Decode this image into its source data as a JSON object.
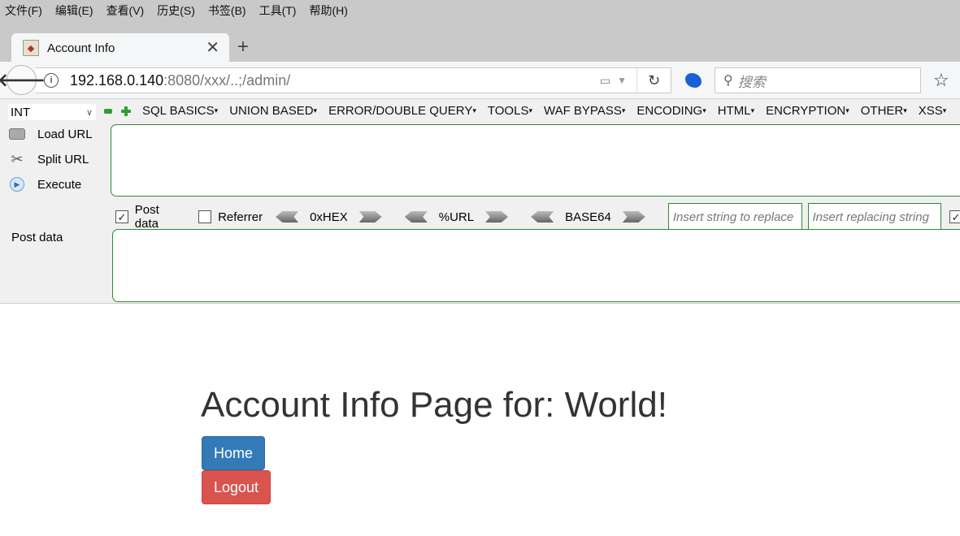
{
  "menubar": {
    "items": [
      "文件(F)",
      "编辑(E)",
      "查看(V)",
      "历史(S)",
      "书签(B)",
      "工具(T)",
      "帮助(H)"
    ]
  },
  "tab": {
    "title": "Account Info",
    "close": "✕",
    "new_tab": "+"
  },
  "navbar": {
    "back": "🡐",
    "info": "i",
    "url_host": "192.168.0.140",
    "url_rest": ":8080/xxx/..;/admin/",
    "reload": "↻",
    "search_placeholder": "搜索",
    "star": "☆"
  },
  "hackbar": {
    "select_value": "INT",
    "menus": [
      "SQL BASICS",
      "UNION BASED",
      "ERROR/DOUBLE QUERY",
      "TOOLS",
      "WAF BYPASS",
      "ENCODING",
      "HTML",
      "ENCRYPTION",
      "OTHER",
      "XSS"
    ],
    "load_url": "Load URL",
    "split_url": "Split URL",
    "execute": "Execute",
    "url_value": "",
    "post_data_checkbox": "Post data",
    "post_data_checked": true,
    "referrer_checkbox": "Referrer",
    "referrer_checked": false,
    "encoders": [
      "0xHEX",
      "%URL",
      "BASE64"
    ],
    "replace_placeholder_1": "Insert string to replace",
    "replace_placeholder_2": "Insert replacing string",
    "post_data_label": "Post data",
    "post_data_value": ""
  },
  "page": {
    "title": "Account Info Page for: World!",
    "home_button": "Home",
    "logout_button": "Logout",
    "home_color": "#337ab7",
    "logout_color": "#d9534f"
  }
}
